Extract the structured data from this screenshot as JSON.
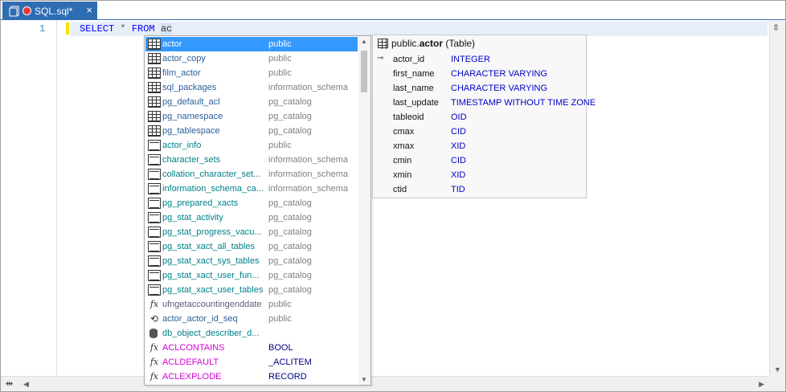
{
  "tab": {
    "title": "SQL.sql*",
    "close": "×"
  },
  "editor": {
    "line_number": "1",
    "code": {
      "select": "SELECT",
      "star": "*",
      "from": "FROM",
      "typed": "ac"
    }
  },
  "completion": {
    "items": [
      {
        "name": "actor",
        "schema": "public",
        "kind": "table",
        "selected": true
      },
      {
        "name": "actor_copy",
        "schema": "public",
        "kind": "table"
      },
      {
        "name": "film_actor",
        "schema": "public",
        "kind": "table"
      },
      {
        "name": "sql_packages",
        "schema": "information_schema",
        "kind": "table"
      },
      {
        "name": "pg_default_acl",
        "schema": "pg_catalog",
        "kind": "table"
      },
      {
        "name": "pg_namespace",
        "schema": "pg_catalog",
        "kind": "table"
      },
      {
        "name": "pg_tablespace",
        "schema": "pg_catalog",
        "kind": "table"
      },
      {
        "name": "actor_info",
        "schema": "public",
        "kind": "view"
      },
      {
        "name": "character_sets",
        "schema": "information_schema",
        "kind": "view"
      },
      {
        "name": "collation_character_set...",
        "schema": "information_schema",
        "kind": "view"
      },
      {
        "name": "information_schema_ca...",
        "schema": "information_schema",
        "kind": "view"
      },
      {
        "name": "pg_prepared_xacts",
        "schema": "pg_catalog",
        "kind": "view"
      },
      {
        "name": "pg_stat_activity",
        "schema": "pg_catalog",
        "kind": "view"
      },
      {
        "name": "pg_stat_progress_vacu...",
        "schema": "pg_catalog",
        "kind": "view"
      },
      {
        "name": "pg_stat_xact_all_tables",
        "schema": "pg_catalog",
        "kind": "view"
      },
      {
        "name": "pg_stat_xact_sys_tables",
        "schema": "pg_catalog",
        "kind": "view"
      },
      {
        "name": "pg_stat_xact_user_fun...",
        "schema": "pg_catalog",
        "kind": "view"
      },
      {
        "name": "pg_stat_xact_user_tables",
        "schema": "pg_catalog",
        "kind": "view"
      },
      {
        "name": "ufngetaccountingenddate",
        "schema": "public",
        "kind": "function"
      },
      {
        "name": "actor_actor_id_seq",
        "schema": "public",
        "kind": "sequence"
      },
      {
        "name": "db_object_describer_d...",
        "schema": "",
        "kind": "database"
      },
      {
        "name": "ACLCONTAINS",
        "schema": "BOOL",
        "kind": "builtin"
      },
      {
        "name": "ACLDEFAULT",
        "schema": "_ACLITEM",
        "kind": "builtin"
      },
      {
        "name": "ACLEXPLODE",
        "schema": "RECORD",
        "kind": "builtin"
      }
    ]
  },
  "details": {
    "schema_prefix": "public.",
    "table_name": "actor",
    "kind_label": "(Table)",
    "columns": [
      {
        "name": "actor_id",
        "type": "INTEGER",
        "primary_key": true
      },
      {
        "name": "first_name",
        "type": "CHARACTER VARYING"
      },
      {
        "name": "last_name",
        "type": "CHARACTER VARYING"
      },
      {
        "name": "last_update",
        "type": "TIMESTAMP WITHOUT TIME ZONE"
      },
      {
        "name": "tableoid",
        "type": "OID"
      },
      {
        "name": "cmax",
        "type": "CID"
      },
      {
        "name": "xmax",
        "type": "XID"
      },
      {
        "name": "cmin",
        "type": "CID"
      },
      {
        "name": "xmin",
        "type": "XID"
      },
      {
        "name": "ctid",
        "type": "TID"
      }
    ]
  }
}
